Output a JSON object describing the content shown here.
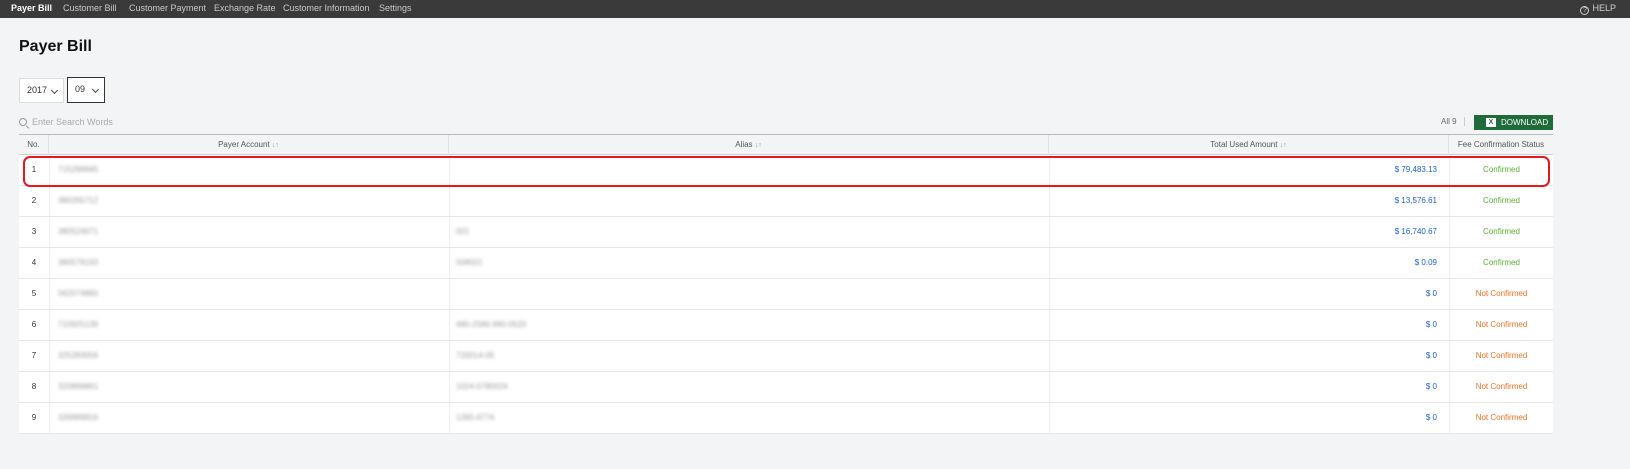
{
  "nav": {
    "tabs": [
      {
        "label": "Payer Bill",
        "active": true
      },
      {
        "label": "Customer Bill",
        "active": false
      },
      {
        "label": "Customer Payment",
        "active": false
      },
      {
        "label": "Exchange Rate",
        "active": false
      },
      {
        "label": "Customer Information",
        "active": false
      },
      {
        "label": "Settings",
        "active": false
      }
    ],
    "help_label": "HELP",
    "help_icon": "question-circle-icon"
  },
  "page": {
    "title": "Payer Bill"
  },
  "filters": {
    "year": "2017",
    "month": "09"
  },
  "search": {
    "placeholder": "Enter Search Words",
    "icon": "search-icon"
  },
  "toolbar": {
    "count_label": "All 9",
    "download_label": "DOWNLOAD",
    "download_icon": "excel-icon"
  },
  "table": {
    "headers": {
      "no": "No.",
      "payer_account": "Payer Account",
      "alias": "Alias",
      "total_used_amount": "Total Used Amount",
      "fee_confirmation_status": "Fee Confirmation Status"
    },
    "sort_glyph": "↓↑",
    "rows": [
      {
        "no": "1",
        "account": "715298845",
        "alias": "",
        "amount": "$ 79,483.13",
        "status": "Confirmed"
      },
      {
        "no": "2",
        "account": "380265712",
        "alias": "",
        "amount": "$ 13,576.61",
        "status": "Confirmed"
      },
      {
        "no": "3",
        "account": "380524671",
        "alias": "001",
        "amount": "$ 16,740.67",
        "status": "Confirmed"
      },
      {
        "no": "4",
        "account": "380578193",
        "alias": "558021",
        "amount": "$ 0.09",
        "status": "Confirmed"
      },
      {
        "no": "5",
        "account": "562074860",
        "alias": "",
        "amount": "$ 0",
        "status": "Not Confirmed"
      },
      {
        "no": "6",
        "account": "710925139",
        "alias": "480-2586-990-0520",
        "amount": "$ 0",
        "status": "Not Confirmed"
      },
      {
        "no": "7",
        "account": "325283056",
        "alias": "720014-05",
        "amount": "$ 0",
        "status": "Not Confirmed"
      },
      {
        "no": "8",
        "account": "320899861",
        "alias": "1024-0780024",
        "amount": "$ 0",
        "status": "Not Confirmed"
      },
      {
        "no": "9",
        "account": "326889816",
        "alias": "1265-6774",
        "amount": "$ 0",
        "status": "Not Confirmed"
      }
    ]
  },
  "colors": {
    "confirmed": "#58b030",
    "not_confirmed": "#f07020",
    "amount": "#1a5fd6",
    "highlight": "#e8161e",
    "download": "#1f6b3a"
  }
}
